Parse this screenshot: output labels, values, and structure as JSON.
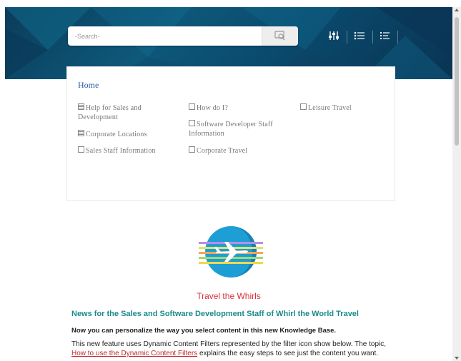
{
  "search": {
    "placeholder": "-Search-"
  },
  "toolbar": {
    "filter_icon": "filter-sliders-icon",
    "toc_icon": "toc-list-icon",
    "index_icon": "index-list-icon"
  },
  "toc": {
    "home_label": "Home",
    "items": [
      {
        "label": "Help for Sales and Development",
        "icon": "book-icon"
      },
      {
        "label": "Corporate Locations",
        "icon": "book-icon"
      },
      {
        "label": "Sales Staff Information",
        "icon": "page-icon"
      },
      {
        "label": "How do I?",
        "icon": "page-icon"
      },
      {
        "label": "Software Developer Staff Information",
        "icon": "page-icon"
      },
      {
        "label": "Corporate Travel",
        "icon": "page-icon"
      },
      {
        "label": "Leisure Travel",
        "icon": "page-icon"
      }
    ]
  },
  "content": {
    "site_title": "Travel the Whirls",
    "news_heading": "News for the Sales and Software Development Staff of Whirl the World Travel",
    "intro": "Now you can personalize the way you select content in this new Knowledge Base.",
    "para_before": "This new feature uses Dynamic Content Filters represented by the filter icon show below. The topic, ",
    "para_link": "How to use the Dynamic Content Filters",
    "para_after": " explains the easy steps to see just the content you want."
  },
  "colors": {
    "header_bg": "#0e587a",
    "link": "#2a5ba8",
    "title_red": "#d9303d",
    "heading_teal": "#1a8a8a"
  }
}
